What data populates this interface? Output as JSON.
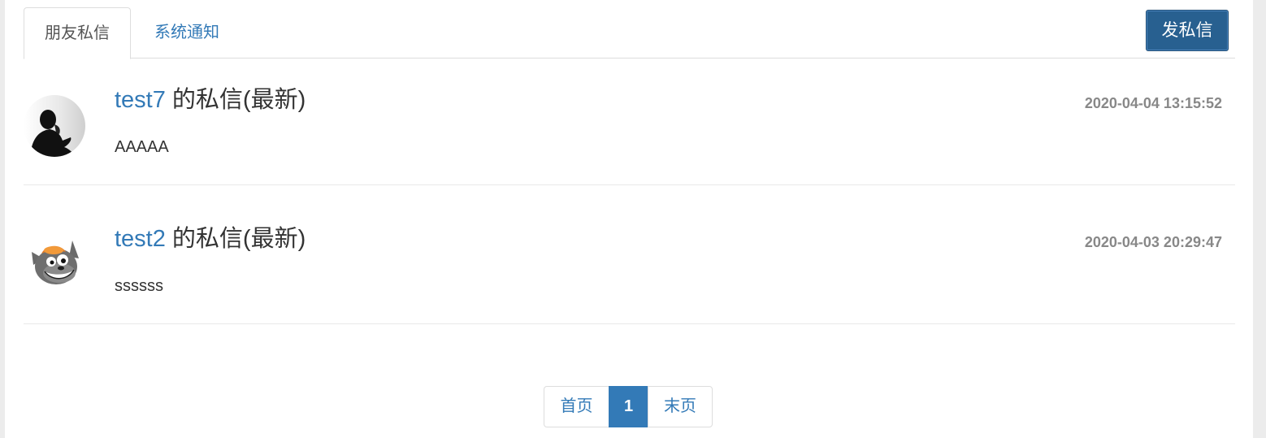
{
  "tabs": [
    {
      "label": "朋友私信",
      "active": true
    },
    {
      "label": "系统通知",
      "active": false
    }
  ],
  "toolbar": {
    "send_label": "发私信"
  },
  "messages": [
    {
      "user": "test7",
      "suffix": " 的私信(最新)",
      "time": "2020-04-04 13:15:52",
      "content": "AAAAA",
      "avatar": "silhouette-avatar"
    },
    {
      "user": "test2",
      "suffix": " 的私信(最新)",
      "time": "2020-04-03 20:29:47",
      "content": "ssssss",
      "avatar": "cartoon-wolf-avatar"
    }
  ],
  "pagination": {
    "first": "首页",
    "current": "1",
    "last": "末页"
  },
  "colors": {
    "link": "#337ab7",
    "primary_button": "#286090",
    "active_page": "#337ab7",
    "timestamp": "#888888"
  }
}
